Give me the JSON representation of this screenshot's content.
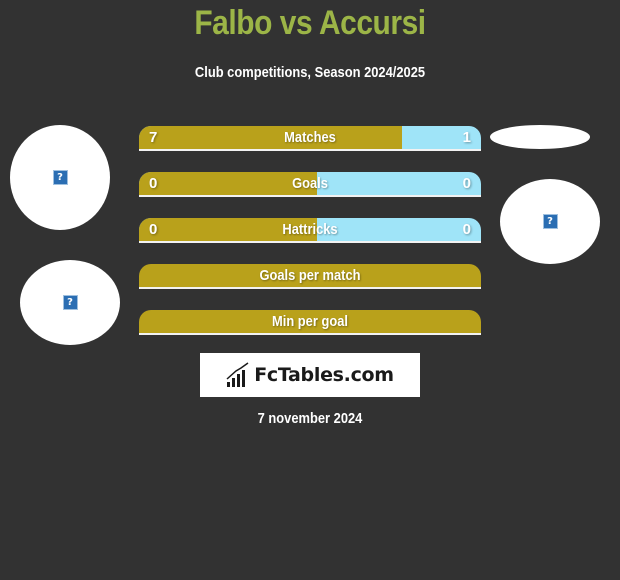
{
  "header": {
    "title": "Falbo vs Accursi",
    "subtitle": "Club competitions, Season 2024/2025"
  },
  "colors": {
    "title": "#9cb547",
    "left_bar": "#b9a11b",
    "right_bar": "#9fe4f8",
    "background": "#323232"
  },
  "avatars": {
    "left_1": {
      "icon": "broken-image-icon",
      "glyph": "?"
    },
    "left_2": {
      "icon": "broken-image-icon",
      "glyph": "?"
    },
    "right_2": {
      "icon": "broken-image-icon",
      "glyph": "?"
    }
  },
  "stats": [
    {
      "label": "Matches",
      "left": "7",
      "right": "1",
      "left_share": 0.77
    },
    {
      "label": "Goals",
      "left": "0",
      "right": "0",
      "left_share": 0.52
    },
    {
      "label": "Hattricks",
      "left": "0",
      "right": "0",
      "left_share": 0.52
    },
    {
      "label": "Goals per match"
    },
    {
      "label": "Min per goal"
    }
  ],
  "logo": {
    "text": "FcTables.com",
    "icon": "bar-chart-icon"
  },
  "footer": {
    "date": "7 november 2024"
  }
}
